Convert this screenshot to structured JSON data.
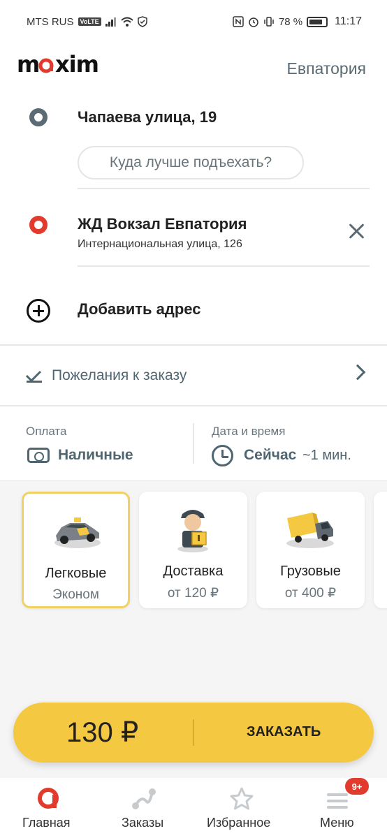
{
  "status_bar": {
    "carrier": "MTS RUS",
    "volte": "VoLTE",
    "battery": "78 %",
    "time": "11:17"
  },
  "header": {
    "logo": "maxim",
    "city": "Евпатория"
  },
  "route": {
    "from": {
      "title": "Чапаева улица, 19",
      "hint": "Куда лучше подъехать?"
    },
    "to": {
      "title": "ЖД Вокзал Евпатория",
      "subtitle": "Интернациональная улица, 126"
    },
    "add_address": "Добавить адрес"
  },
  "wishes": {
    "label": "Пожелания к заказу"
  },
  "payment": {
    "label": "Оплата",
    "value": "Наличные"
  },
  "datetime": {
    "label": "Дата и время",
    "value": "Сейчас",
    "eta": "~1 мин."
  },
  "tariffs": [
    {
      "title": "Легковые",
      "subtitle": "Эконом",
      "icon": "car-icon",
      "selected": true
    },
    {
      "title": "Доставка",
      "subtitle": "от 120 ₽",
      "icon": "courier-icon",
      "selected": false
    },
    {
      "title": "Грузовые",
      "subtitle": "от 400 ₽",
      "icon": "truck-icon",
      "selected": false
    }
  ],
  "order": {
    "price": "130 ₽",
    "label": "ЗАКАЗАТЬ"
  },
  "nav": {
    "items": [
      {
        "label": "Главная",
        "icon": "home-icon",
        "active": true
      },
      {
        "label": "Заказы",
        "icon": "orders-icon",
        "active": false
      },
      {
        "label": "Избранное",
        "icon": "star-icon",
        "active": false
      },
      {
        "label": "Меню",
        "icon": "menu-icon",
        "active": false
      }
    ],
    "menu_badge": "9+"
  },
  "colors": {
    "brand_red": "#e23b2e",
    "accent_yellow": "#f5c842",
    "text_slate": "#4f6672",
    "from_dot": "#5b6b74"
  }
}
